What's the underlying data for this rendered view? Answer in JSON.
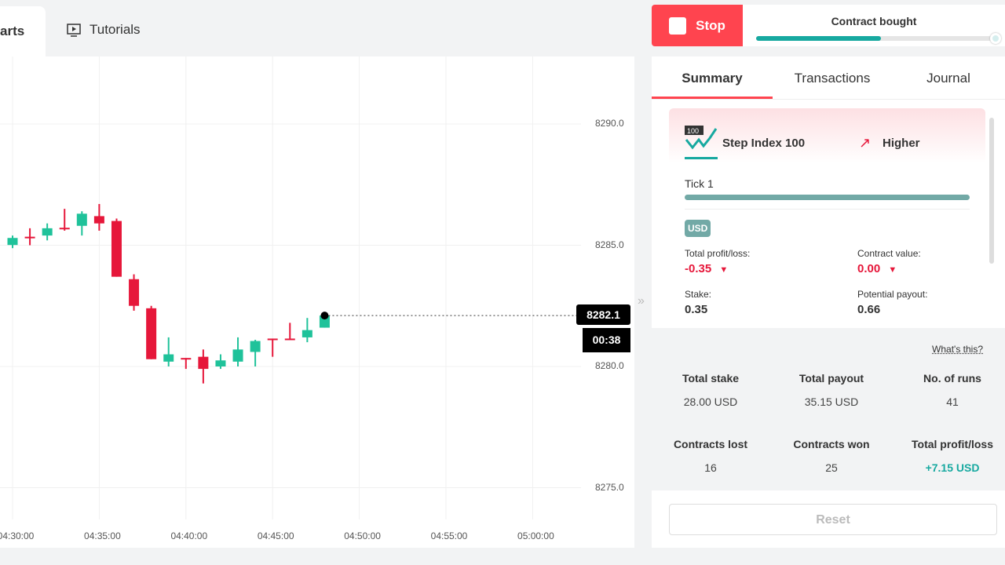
{
  "top_tabs": {
    "charts": "arts",
    "tutorials": "Tutorials"
  },
  "chart_data": {
    "type": "candlestick",
    "y_ticks": [
      "8290.0",
      "8285.0",
      "8280.0",
      "8275.0"
    ],
    "y_tick_values": [
      8290,
      8285,
      8280,
      8275
    ],
    "x_ticks": [
      "04:30:00",
      "04:35:00",
      "04:40:00",
      "04:45:00",
      "04:50:00",
      "04:55:00",
      "05:00:00"
    ],
    "grid": true,
    "candles": [
      {
        "t": "04:30",
        "o": 8285.01,
        "h": 8285.4,
        "l": 8284.88,
        "c": 8285.3
      },
      {
        "t": "04:31",
        "o": 8285.35,
        "h": 8285.7,
        "l": 8285.0,
        "c": 8285.32
      },
      {
        "t": "04:32",
        "o": 8285.4,
        "h": 8285.9,
        "l": 8285.2,
        "c": 8285.7
      },
      {
        "t": "04:33",
        "o": 8285.72,
        "h": 8286.5,
        "l": 8285.6,
        "c": 8285.67
      },
      {
        "t": "04:34",
        "o": 8285.8,
        "h": 8286.4,
        "l": 8285.4,
        "c": 8286.3
      },
      {
        "t": "04:35",
        "o": 8286.2,
        "h": 8286.7,
        "l": 8285.6,
        "c": 8285.9
      },
      {
        "t": "04:36",
        "o": 8286.0,
        "h": 8286.1,
        "l": 8283.7,
        "c": 8283.7
      },
      {
        "t": "04:37",
        "o": 8283.6,
        "h": 8283.8,
        "l": 8282.3,
        "c": 8282.5
      },
      {
        "t": "04:38",
        "o": 8282.4,
        "h": 8282.5,
        "l": 8280.3,
        "c": 8280.3
      },
      {
        "t": "04:39",
        "o": 8280.2,
        "h": 8281.2,
        "l": 8280.0,
        "c": 8280.5
      },
      {
        "t": "04:40",
        "o": 8280.35,
        "h": 8280.35,
        "l": 8279.9,
        "c": 8280.3
      },
      {
        "t": "04:41",
        "o": 8280.4,
        "h": 8280.7,
        "l": 8279.3,
        "c": 8279.9
      },
      {
        "t": "04:42",
        "o": 8280.0,
        "h": 8280.5,
        "l": 8279.9,
        "c": 8280.25
      },
      {
        "t": "04:43",
        "o": 8280.2,
        "h": 8281.2,
        "l": 8280.0,
        "c": 8280.7
      },
      {
        "t": "04:44",
        "o": 8280.6,
        "h": 8281.1,
        "l": 8280.0,
        "c": 8281.05
      },
      {
        "t": "04:45",
        "o": 8281.15,
        "h": 8281.15,
        "l": 8280.4,
        "c": 8281.1
      },
      {
        "t": "04:46",
        "o": 8281.15,
        "h": 8281.8,
        "l": 8281.1,
        "c": 8281.1
      },
      {
        "t": "04:47",
        "o": 8281.2,
        "h": 8282.0,
        "l": 8281.0,
        "c": 8281.5
      },
      {
        "t": "04:48",
        "o": 8281.6,
        "h": 8282.1,
        "l": 8281.6,
        "c": 8282.1
      }
    ],
    "current_price": "8282.1",
    "countdown": "00:38",
    "colors": {
      "up": "#1fc29a",
      "down": "#e6173a"
    }
  },
  "trade": {
    "stop_label": "Stop",
    "status": "Contract bought",
    "progress_percent": 52,
    "tabs": [
      "Summary",
      "Transactions",
      "Journal"
    ],
    "card": {
      "badge": "100",
      "symbol": "Step Index 100",
      "direction": "Higher",
      "tick": "Tick 1",
      "currency": "USD",
      "total_pl_label": "Total profit/loss:",
      "total_pl": "-0.35",
      "contract_value_label": "Contract value:",
      "contract_value": "0.00",
      "stake_label": "Stake:",
      "stake": "0.35",
      "payout_label": "Potential payout:",
      "payout": "0.66"
    },
    "whats_this": "What's this?",
    "stats": [
      {
        "label": "Total stake",
        "value": "28.00 USD"
      },
      {
        "label": "Total payout",
        "value": "35.15 USD"
      },
      {
        "label": "No. of runs",
        "value": "41"
      },
      {
        "label": "Contracts lost",
        "value": "16"
      },
      {
        "label": "Contracts won",
        "value": "25"
      },
      {
        "label": "Total profit/loss",
        "value": "+7.15 USD"
      }
    ],
    "reset_label": "Reset",
    "colors": {
      "accent": "#ff444f",
      "profit": "#17a9a0",
      "loss": "#e6173a"
    }
  }
}
